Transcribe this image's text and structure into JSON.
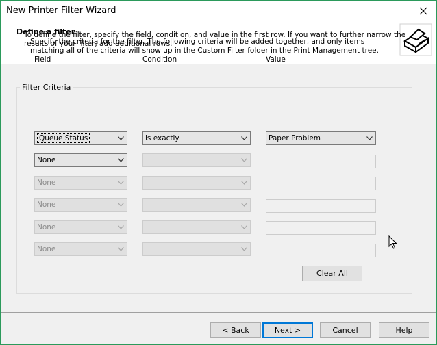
{
  "window": {
    "title": "New Printer Filter Wizard"
  },
  "header": {
    "title": "Define a filter",
    "description": "Specify the criteria for the filter. The following criteria will be added together, and only items matching all of the criteria will show up in the Custom Filter folder in the Print Management tree."
  },
  "criteria": {
    "group_label": "Filter Criteria",
    "description": "To define the filter, specify the field, condition, and value in the first row. If you want to further narrow the results of your filter, add additional rows.",
    "col_field": "Field",
    "col_condition": "Condition",
    "col_value": "Value",
    "rows": [
      {
        "field": "Queue Status",
        "condition": "is exactly",
        "value": "Paper Problem"
      },
      {
        "field": "None",
        "condition": "",
        "value": ""
      },
      {
        "field": "None",
        "condition": "",
        "value": ""
      },
      {
        "field": "None",
        "condition": "",
        "value": ""
      },
      {
        "field": "None",
        "condition": "",
        "value": ""
      },
      {
        "field": "None",
        "condition": "",
        "value": ""
      }
    ],
    "clear_all_label": "Clear All"
  },
  "footer": {
    "back_label": "< Back",
    "next_label": "Next >",
    "cancel_label": "Cancel",
    "help_label": "Help"
  },
  "icons": {
    "close": "close-icon",
    "printer": "printer-icon",
    "dropdown": "chevron-down-icon",
    "cursor": "mouse-cursor-icon"
  },
  "colors": {
    "window_border": "#2b9a5b",
    "default_button_border": "#0078d7",
    "panel_bg": "#f0f0f0"
  }
}
